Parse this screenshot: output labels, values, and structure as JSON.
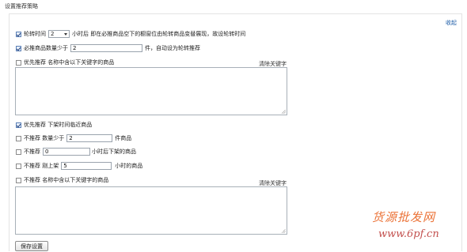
{
  "section_title": "设置推荐策略",
  "collapse_label": "收起",
  "rotation": {
    "checked": true,
    "label_before": "轮转时间",
    "hours_value": "2",
    "label_after": "小时后 即在必推商品空下的橱窗位由轮转商品变替展现，故设轮转时间"
  },
  "must_push": {
    "checked": true,
    "label": "必推商品数量少于",
    "value": "2",
    "label_after": "件，自动设为轮转推荐"
  },
  "priority_keywords": {
    "checked": false,
    "label": "优先推荐 名称中含以下关键字的商品",
    "clear_label": "清除关键字",
    "text": ""
  },
  "priority_delist": {
    "checked": true,
    "label": "优先推荐 下架时间临近商品"
  },
  "min_stock": {
    "checked": false,
    "label": "不推荐 数量少于",
    "value": "2",
    "label_after": "件商品"
  },
  "delist_hours": {
    "checked": false,
    "label": "不推荐",
    "value": "0",
    "label_after": "小时后下架的商品"
  },
  "just_listed": {
    "checked": false,
    "label": "不推荐 刚上架",
    "value": "5",
    "label_after": "小时的商品"
  },
  "exclude_keywords": {
    "checked": false,
    "label": "不推荐 名称中含以下关键字的商品",
    "clear_label": "清除关键字",
    "text": ""
  },
  "save_label": "保存设置",
  "watermark": {
    "line1": "货源批发网",
    "line2": "www.6pf.cn"
  }
}
